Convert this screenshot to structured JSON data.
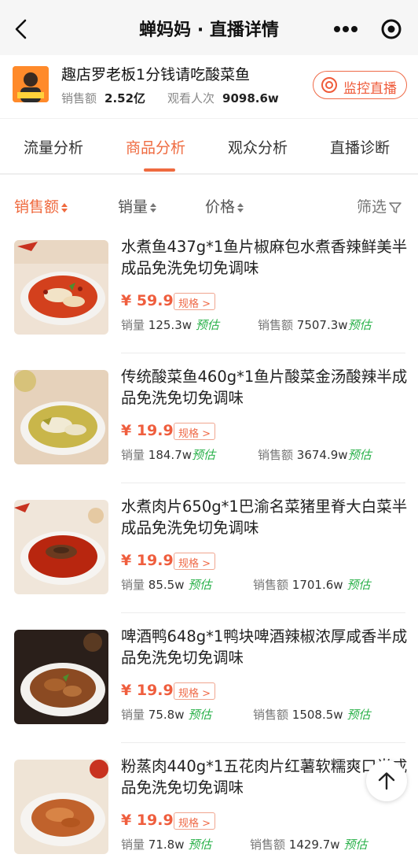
{
  "nav": {
    "title": "蝉妈妈 · 直播详情"
  },
  "header": {
    "live_title": "趣店罗老板1分钱请吃酸菜鱼",
    "sales_label": "销售额",
    "sales_value": "2.52亿",
    "viewers_label": "观看人次",
    "viewers_value": "9098.6w",
    "monitor_button": "监控直播"
  },
  "tabs": [
    {
      "label": "流量分析",
      "active": false
    },
    {
      "label": "商品分析",
      "active": true
    },
    {
      "label": "观众分析",
      "active": false
    },
    {
      "label": "直播诊断",
      "active": false
    }
  ],
  "sorts": {
    "gmv": "销售额",
    "sales": "销量",
    "price": "价格",
    "filter": "筛选"
  },
  "colors": {
    "accent": "#ef6a3f",
    "estimate": "#2ab14a"
  },
  "labels": {
    "spec": "规格",
    "sales": "销量",
    "gmv": "销售额",
    "estimate": "预估"
  },
  "products": [
    {
      "name": "水煮鱼437g*1鱼片椒麻包水煮香辣鲜美半成品免洗免切免调味",
      "price": "¥ 59.9",
      "sales": "125.3w",
      "gmv": "7507.3w"
    },
    {
      "name": "传统酸菜鱼460g*1鱼片酸菜金汤酸辣半成品免洗免切免调味",
      "price": "¥ 19.9",
      "sales": "184.7w",
      "gmv": "3674.9w"
    },
    {
      "name": "水煮肉片650g*1巴渝名菜猪里脊大白菜半成品免洗免切免调味",
      "price": "¥ 19.9",
      "sales": "85.5w",
      "gmv": "1701.6w"
    },
    {
      "name": "啤酒鸭648g*1鸭块啤酒辣椒浓厚咸香半成品免洗免切免调味",
      "price": "¥ 19.9",
      "sales": "75.8w",
      "gmv": "1508.5w"
    },
    {
      "name": "粉蒸肉440g*1五花肉片红薯软糯爽口半成品免洗免切免调味",
      "price": "¥ 19.9",
      "sales": "71.8w",
      "gmv": "1429.7w"
    }
  ]
}
